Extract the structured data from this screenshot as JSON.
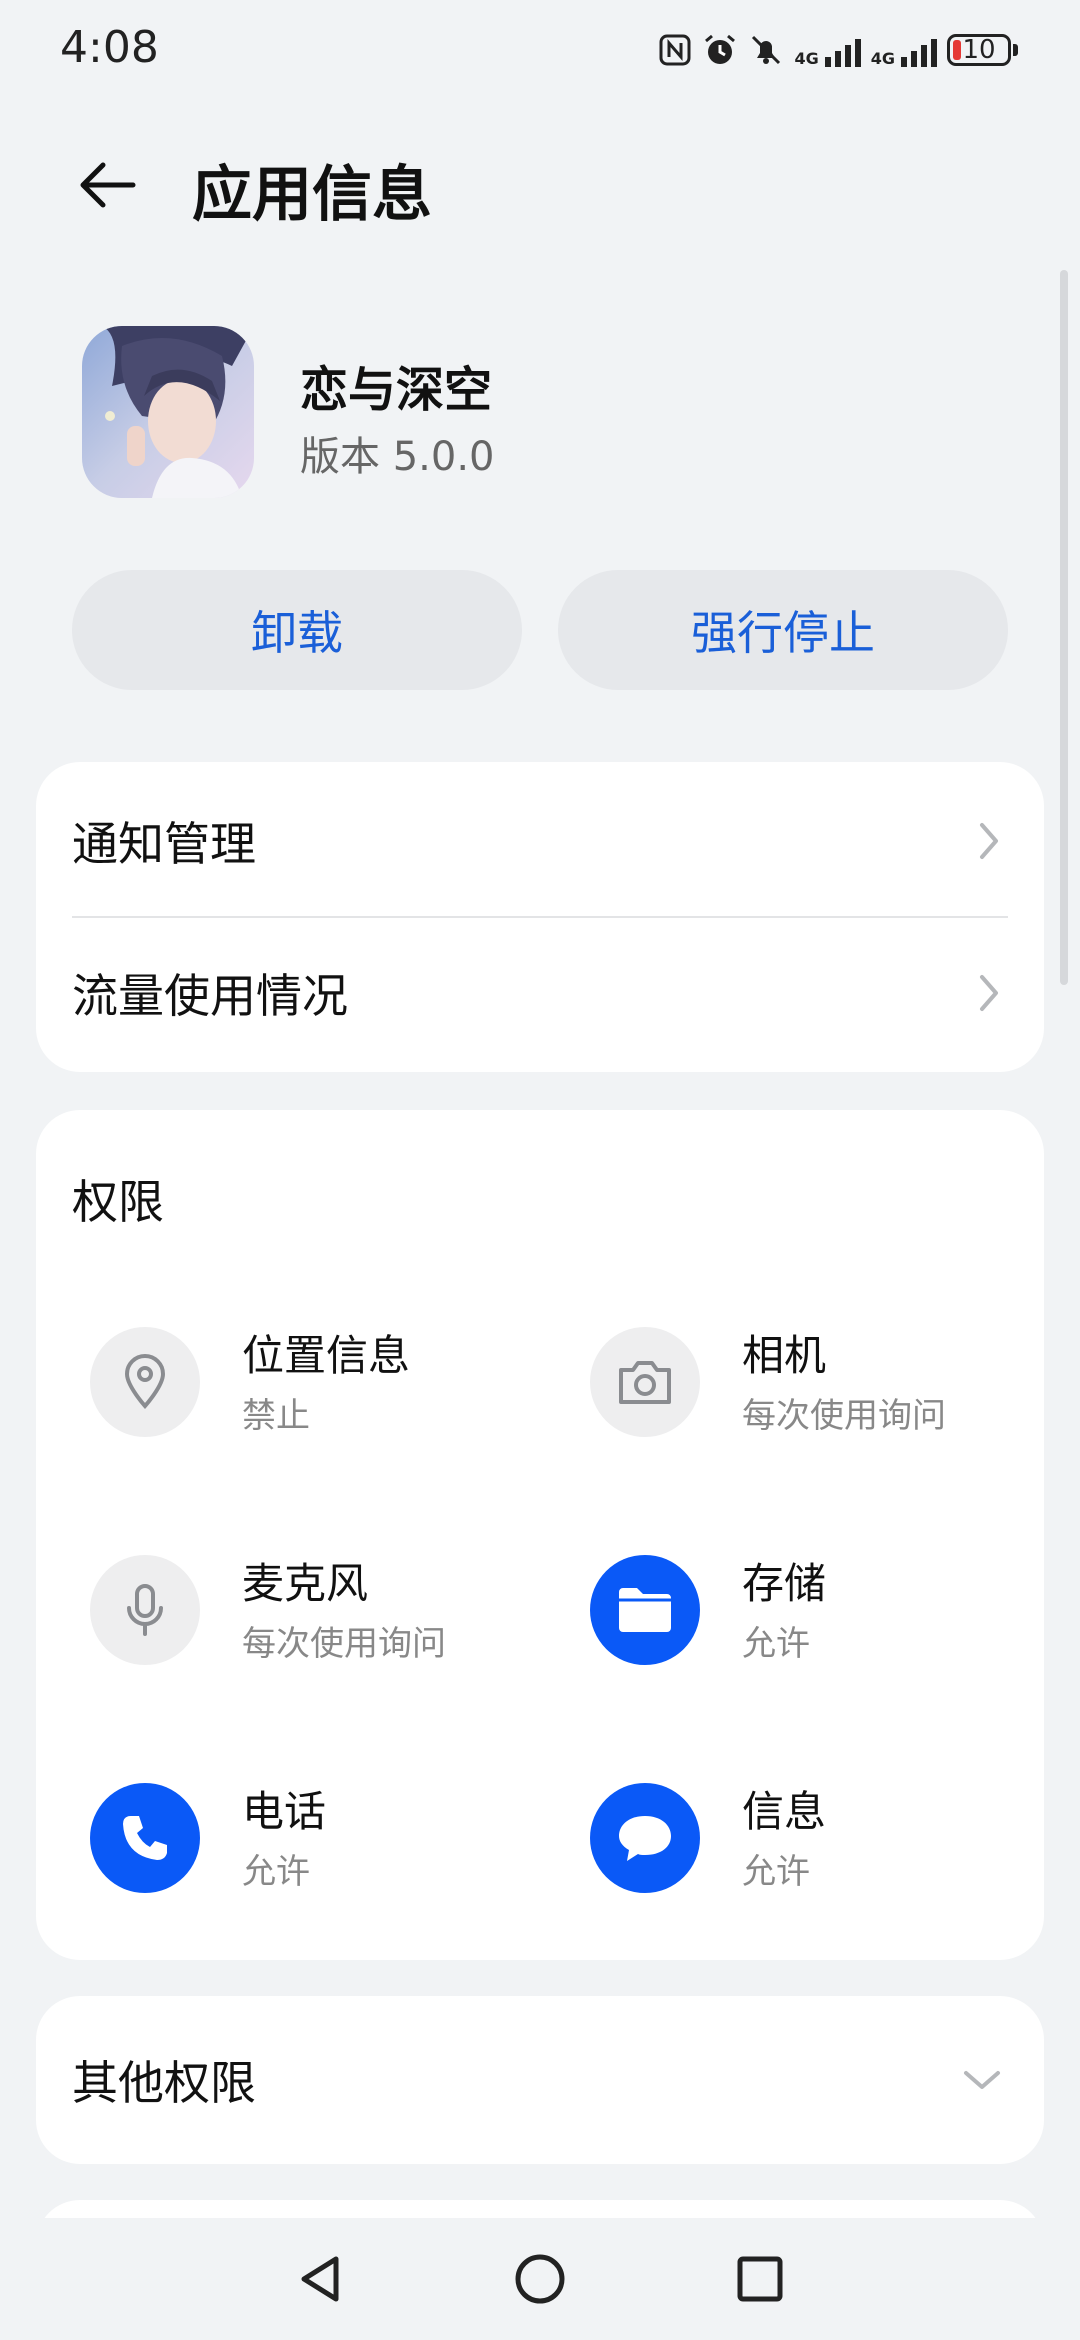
{
  "status_bar": {
    "time": "4:08",
    "network_1": "4G",
    "network_2": "4G",
    "battery_level": "10",
    "icons": [
      "nfc-icon",
      "alarm-icon",
      "mute-icon",
      "signal-icon",
      "signal-icon",
      "battery-icon"
    ]
  },
  "header": {
    "title": "应用信息",
    "back_icon": "arrow-left-icon"
  },
  "app": {
    "name": "恋与深空",
    "version": "版本 5.0.0"
  },
  "actions": {
    "uninstall_label": "卸载",
    "force_stop_label": "强行停止"
  },
  "settings": {
    "items": [
      {
        "label": "通知管理",
        "icon": "chevron-right-icon"
      },
      {
        "label": "流量使用情况",
        "icon": "chevron-right-icon"
      }
    ]
  },
  "permissions": {
    "title": "权限",
    "items": [
      {
        "name": "位置信息",
        "status": "禁止",
        "icon": "location-pin-icon",
        "enabled": false
      },
      {
        "name": "相机",
        "status": "每次使用询问",
        "icon": "camera-icon",
        "enabled": false
      },
      {
        "name": "麦克风",
        "status": "每次使用询问",
        "icon": "microphone-icon",
        "enabled": false
      },
      {
        "name": "存储",
        "status": "允许",
        "icon": "folder-icon",
        "enabled": true
      },
      {
        "name": "电话",
        "status": "允许",
        "icon": "phone-icon",
        "enabled": true
      },
      {
        "name": "信息",
        "status": "允许",
        "icon": "message-icon",
        "enabled": true
      }
    ]
  },
  "other_permissions": {
    "label": "其他权限",
    "icon": "chevron-down-icon"
  },
  "colors": {
    "accent": "#0a59f7",
    "button_text": "#1a5fd8",
    "background": "#f1f3f5",
    "card": "#ffffff"
  }
}
